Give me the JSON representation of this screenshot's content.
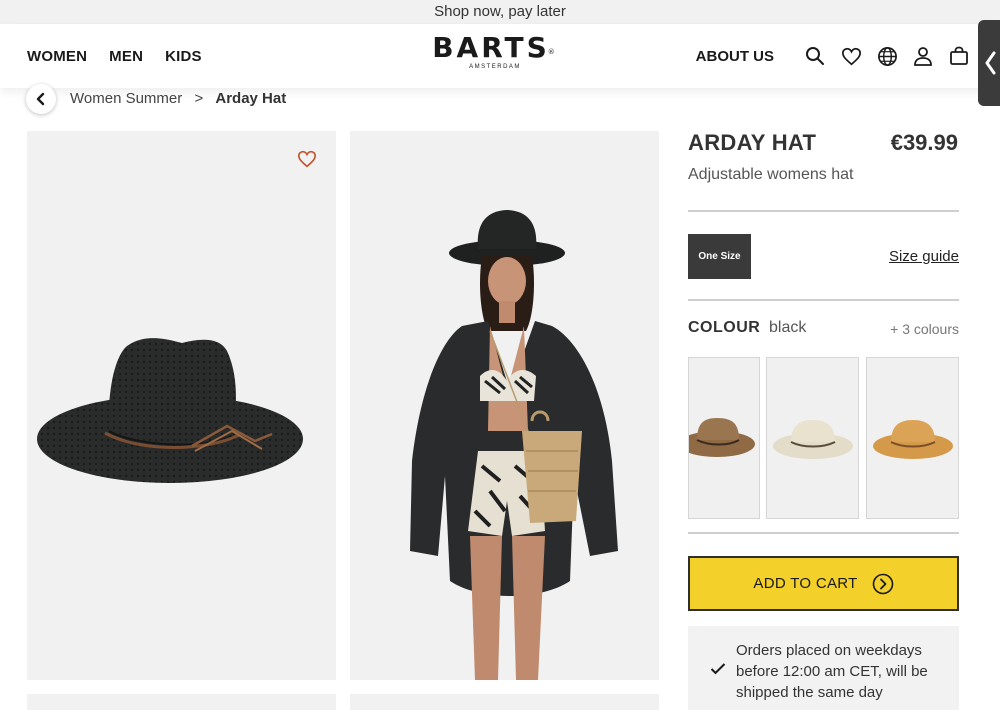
{
  "promo": {
    "text": "Shop now, pay later"
  },
  "header": {
    "nav": [
      "WOMEN",
      "MEN",
      "KIDS"
    ],
    "logo": {
      "main": "BARTS",
      "registered": "®",
      "sub": "AMSTERDAM"
    },
    "about": "ABOUT US",
    "icons": [
      "search-icon",
      "heart-icon",
      "globe-icon",
      "user-icon",
      "bag-icon"
    ]
  },
  "breadcrumb": {
    "parent": "Women Summer",
    "separator": ">",
    "current": "Arday Hat"
  },
  "product": {
    "name": "ARDAY HAT",
    "price": "€39.99",
    "description": "Adjustable womens hat",
    "size": "One Size",
    "size_guide": "Size guide",
    "colour_label": "COLOUR",
    "colour_value": "black",
    "more_colours": "+ 3 colours",
    "swatches": [
      "brown",
      "cream",
      "tan"
    ],
    "add_to_cart": "ADD TO CART",
    "shipping_note": "Orders placed on weekdays before 12:00 am CET, will be shipped the same day"
  },
  "colors": {
    "cart": "#f3d02a",
    "dark": "#3a3a3a",
    "wishlist": "#c0562f"
  }
}
